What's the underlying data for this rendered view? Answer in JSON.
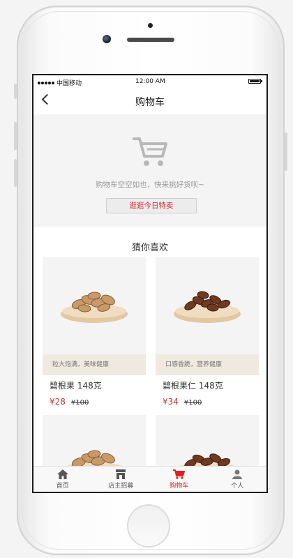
{
  "statusbar": {
    "carrier": "中国移动",
    "time": "12:00 AM"
  },
  "navbar": {
    "title": "购物车"
  },
  "empty_cart": {
    "message": "购物车空空如也，快来挑好货呗~",
    "button_label": "逛逛今日特卖"
  },
  "recommend": {
    "title": "猜你喜欢",
    "products": [
      {
        "name": "碧根果  148克",
        "tagline": "粒大饱满，美味健康",
        "price": "¥28",
        "old_price": "¥100",
        "nut": "pecan-in-shell"
      },
      {
        "name": "碧根果仁  148克",
        "tagline": "口感香脆，营养健康",
        "price": "¥34",
        "old_price": "¥100",
        "nut": "pecan-kernel"
      },
      {
        "nut": "pecan-in-shell"
      },
      {
        "nut": "pecan-kernel"
      }
    ]
  },
  "tabbar": {
    "tabs": [
      {
        "label": "首页",
        "icon": "home-icon"
      },
      {
        "label": "店主招募",
        "icon": "store-icon"
      },
      {
        "label": "购物车",
        "icon": "cart-icon",
        "active": true
      },
      {
        "label": "个人",
        "icon": "user-icon"
      }
    ]
  },
  "colors": {
    "accent": "#e02020",
    "price": "#c0392b",
    "tagline_bg": "#efe9df",
    "empty_bg": "#f4f4f4"
  }
}
